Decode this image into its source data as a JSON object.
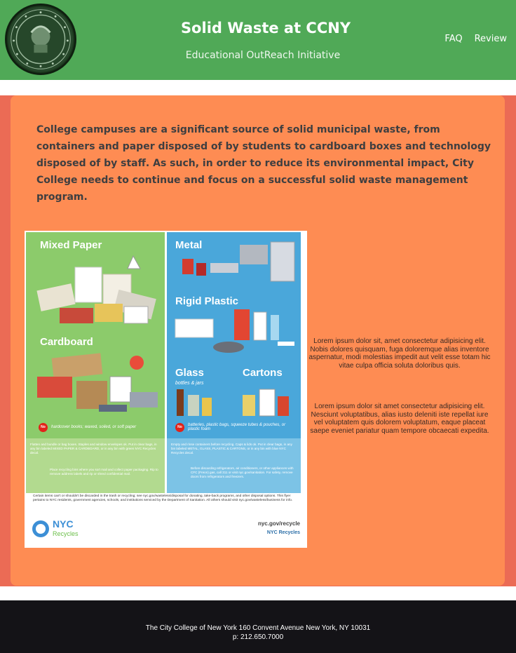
{
  "header": {
    "title": "Solid Waste at CCNY",
    "subtitle": "Educational OutReach Initiative",
    "nav": [
      "FAQ",
      "Review"
    ],
    "logo_icon": "ccny-seal-icon",
    "bg_color": "#50a957"
  },
  "main": {
    "intro": "College campuses are a significant source of solid municipal waste, from containers and paper disposed of by students to cardboard boxes and technology disposed of by staff. As such, in order to reduce its environmental impact, City College needs to continue and focus on a successful solid waste management program.",
    "poster": {
      "sections": [
        "Mixed Paper",
        "Cardboard",
        "Metal",
        "Rigid Plastic",
        "Glass",
        "Cartons"
      ],
      "glass_sub": "bottles & jars",
      "no_badge": "No",
      "no_paper": "hardcover books; waxed, soiled, or soft paper",
      "no_containers": "batteries, plastic bags, squeeze tubes & pouches, or plastic foam",
      "paper_instructions": "Flatten and bundle or bag boxes. Staples and window envelopes ok. Put in clear bags, in any bin labeled MIXED PAPER & CARDBOARD, or in any bin with green NYC Recycles decal.",
      "paper_tip": "Place recycling bins where you sort mail and collect paper packaging. Rip to remove address labels and rip or shred confidential mail.",
      "container_instructions": "Empty and rinse containers before recycling. Caps & lids ok. Put in clear bags, in any bin labeled METAL, GLASS, PLASTIC & CARTONS, or in any bin with blue NYC Recycles decal.",
      "container_tip": "Before discarding refrigerators, air conditioners, or other appliances with CFC (Freon) gas, call 311 or visit nyc.gov/sanitation. For safety, remove doors from refrigerators and freezers.",
      "footnote": "Certain items can't or shouldn't be discarded in the trash or recycling; see nyc.gov/wasteless/disposal for donating, take-back programs, and other disposal options. This flyer pertains to NYC residents, government agencies, schools, and institutions serviced by the Department of Sanitation. All others should visit nyc.gov/wasteless/business for info.",
      "brand": "NYC",
      "brand_sub": "Recycles",
      "url": "nyc.gov/recycle",
      "social": "NYC Recycles"
    },
    "lorem1": "Lorem ipsum dolor sit, amet consectetur adipisicing elit. Nobis dolores quisquam, fuga doloremque alias inventore aspernatur, modi molestias impedit aut velit esse totam hic vitae culpa officia soluta doloribus quis.",
    "lorem2": "Lorem ipsum dolor sit amet consectetur adipisicing elit. Nesciunt voluptatibus, alias iusto deleniti iste repellat iure vel voluptatem quis dolorem voluptatum, eaque placeat saepe eveniet pariatur quam tempore obcaecati expedita.",
    "card_color": "#fe8c53",
    "band_color": "#eb6b55"
  },
  "footer": {
    "address": "The City College of New York 160 Convent Avenue New York, NY 10031",
    "phone": "p: 212.650.7000"
  }
}
